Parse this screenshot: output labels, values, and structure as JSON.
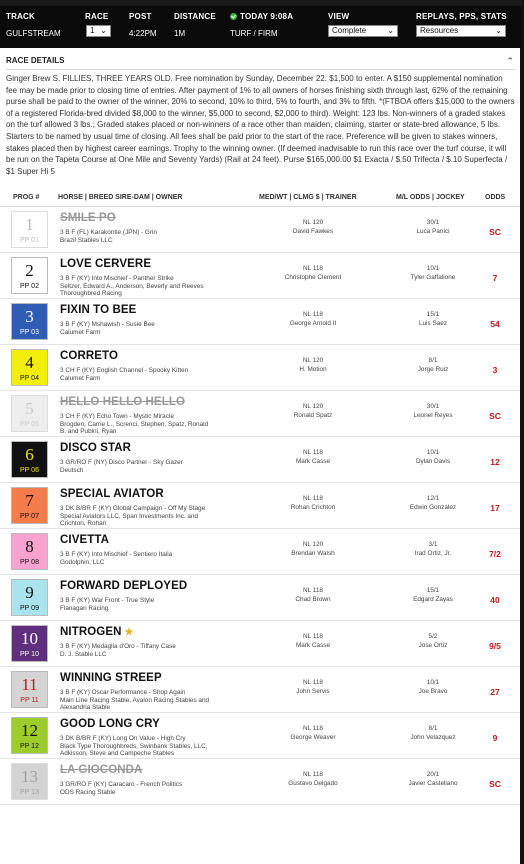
{
  "header": {
    "track_label": "TRACK",
    "track_value": "GULFSTREAM",
    "race_label": "RACE",
    "race_value": "1",
    "post_label": "POST",
    "post_value": "4:22PM",
    "distance_label": "DISTANCE",
    "distance_value": "1M",
    "today_label": "TODAY 9:08A",
    "surface_value": "TURF / FIRM",
    "view_label": "VIEW",
    "view_value": "Complete",
    "replays_label": "REPLAYS, PPS, STATS",
    "replays_value": "Resources"
  },
  "race_details": {
    "title": "RACE DETAILS",
    "text": "Ginger Brew S. FILLIES, THREE YEARS OLD. Free nomination by Sunday, December 22. $1,500 to enter. A $150 supplemental nomination fee may be made prior to closing time of entries. After payment of 1% to all owners of horses finishing sixth through last, 62% of the remaining purse shall be paid to the owner of the winner, 20% to second, 10% to third, 5% to fourth, and 3% to fifth. *(FTBOA offers $15,000 to the owners of a registered Florida-bred divided $8,000 to the winner, $5,000 to second, $2,000 to third). Weight: 123 lbs. Non-winners of a graded stakes on the turf allowed 3 lbs.; Graded stakes placed or non-winners of a race other than maiden, claiming, starter or state-bred allowance, 5 lbs. Starters to be named by usual time of closing. All fees shall be paid prior to the start of the race. Preference will be given to stakes winners, stakes placed then by highest career earnings. Trophy to the winning owner. (If deemed inadvisable to run this race over the turf course, it will be run on the Tapeta Course at One Mile and Seventy Yards) (Rail at 24 feet). Purse $165,000.00 $1 Exacta / $.50 Trifecta / $.10 Superfecta / $1 Super Hi 5"
  },
  "columns": {
    "prog": "PROG #",
    "horse": "HORSE | BREED SIRE-DAM | OWNER",
    "med": "MED/WT | CLMG $ | TRAINER",
    "ml": "M/L ODDS | JOCKEY",
    "odds": "ODDS"
  },
  "colors": {
    "header_bg": "#0b0b0b",
    "odds_red": "#c0171d",
    "scratched": "#999999"
  },
  "entries": [
    {
      "num": "1",
      "pp": "PP 01",
      "name": "SMILE PO",
      "scratched": true,
      "star": false,
      "line1": "3 B F (FL) Karakontie (JPN) - Grin",
      "line2": "Brazil Stables LLC",
      "line3": "",
      "med": "NL 120",
      "trainer": "David Fawkes",
      "ml": "30/1",
      "jockey": "Luca Panici",
      "odds": "SC",
      "bg": "#ffffff",
      "fg": "#777777"
    },
    {
      "num": "2",
      "pp": "PP 02",
      "name": "LOVE CERVERE",
      "scratched": false,
      "star": false,
      "line1": "3 B F (KY) Into Mischief - Panther Strike",
      "line2": "Seltzer, Edward A., Anderson, Beverly and Reeves",
      "line3": "Thoroughbred Racing",
      "med": "NL 118",
      "trainer": "Christophe Clement",
      "ml": "10/1",
      "jockey": "Tyler Gaffalione",
      "odds": "7",
      "bg": "#ffffff",
      "fg": "#111111"
    },
    {
      "num": "3",
      "pp": "PP 03",
      "name": "FIXIN TO BEE",
      "scratched": false,
      "star": false,
      "line1": "3 B F (KY) Mshawish - Susie Bee",
      "line2": "Calumet Farm",
      "line3": "",
      "med": "NL 118",
      "trainer": "George Arnold II",
      "ml": "15/1",
      "jockey": "Luis Saez",
      "odds": "54",
      "bg": "#2f5db4",
      "fg": "#ffffff"
    },
    {
      "num": "4",
      "pp": "PP 04",
      "name": "CORRETO",
      "scratched": false,
      "star": false,
      "line1": "3 CH F (KY) English Channel - Spooky Kitten",
      "line2": "Calumet Farm",
      "line3": "",
      "med": "NL 120",
      "trainer": "H. Motion",
      "ml": "8/1",
      "jockey": "Jorge Ruiz",
      "odds": "3",
      "bg": "#f2ee0b",
      "fg": "#111111"
    },
    {
      "num": "5",
      "pp": "PP 05",
      "name": "HELLO HELLO HELLO",
      "scratched": true,
      "star": false,
      "line1": "3 CH F (KY) Echo Town - Mystic Miracle",
      "line2": "Brogden, Carrie L., Screnci, Stephen, Spatz, Ronald",
      "line3": "B. and Pubini, Ryan",
      "med": "NL 120",
      "trainer": "Ronald Spatz",
      "ml": "30/1",
      "jockey": "Leonel Reyes",
      "odds": "SC",
      "bg": "#dcdcdc",
      "fg": "#999999"
    },
    {
      "num": "6",
      "pp": "PP 06",
      "name": "DISCO STAR",
      "scratched": false,
      "star": false,
      "line1": "3 GR/RO F (NY) Disco Partner - Sky Gazer",
      "line2": "Deutsch",
      "line3": "",
      "med": "NL 118",
      "trainer": "Mark Casse",
      "ml": "10/1",
      "jockey": "Dylan Davis",
      "odds": "12",
      "bg": "#111111",
      "fg": "#f2e80b"
    },
    {
      "num": "7",
      "pp": "PP 07",
      "name": "SPECIAL AVIATOR",
      "scratched": false,
      "star": false,
      "line1": "3 DK B/BR F (KY) Global Campaign - Off My Stage",
      "line2": "Special Aviators LLC, Span Investments Inc. and",
      "line3": "Crichton, Rohan",
      "med": "NL 118",
      "trainer": "Rohan Crichton",
      "ml": "12/1",
      "jockey": "Edwin Gonzalez",
      "odds": "17",
      "bg": "#f47c4a",
      "fg": "#111111"
    },
    {
      "num": "8",
      "pp": "PP 08",
      "name": "CIVETTA",
      "scratched": false,
      "star": false,
      "line1": "3 B F (KY) Into Mischief - Sentiero Italia",
      "line2": "Godolphin, LLC",
      "line3": "",
      "med": "NL 120",
      "trainer": "Brendan Walsh",
      "ml": "3/1",
      "jockey": "Irad Ortiz, Jr.",
      "odds": "7/2",
      "bg": "#f6a3cf",
      "fg": "#111111"
    },
    {
      "num": "9",
      "pp": "PP 09",
      "name": "FORWARD DEPLOYED",
      "scratched": false,
      "star": false,
      "line1": "3 B F (KY) War Front - True Style",
      "line2": "Flanagan Racing",
      "line3": "",
      "med": "NL 118",
      "trainer": "Chad Brown",
      "ml": "15/1",
      "jockey": "Edgard Zayas",
      "odds": "40",
      "bg": "#a8e3ee",
      "fg": "#111111"
    },
    {
      "num": "10",
      "pp": "PP 10",
      "name": "NITROGEN",
      "scratched": false,
      "star": true,
      "line1": "3 B F (KY) Medaglia d'Oro - Tiffany Case",
      "line2": "D. J. Stable LLC",
      "line3": "",
      "med": "NL 118",
      "trainer": "Mark Casse",
      "ml": "5/2",
      "jockey": "Jose Ortiz",
      "odds": "9/5",
      "bg": "#5f2f7d",
      "fg": "#ffffff"
    },
    {
      "num": "11",
      "pp": "PP 11",
      "name": "WINNING STREEP",
      "scratched": false,
      "star": false,
      "line1": "3 B F (KY) Oscar Performance - Shop Again",
      "line2": "Main Line Racing Stable, Avalon Racing Stables and",
      "line3": "Alexandria Stable",
      "med": "NL 118",
      "trainer": "John Servis",
      "ml": "10/1",
      "jockey": "Joe Bravo",
      "odds": "27",
      "bg": "#d4d4d4",
      "fg": "#c0171d"
    },
    {
      "num": "12",
      "pp": "PP 12",
      "name": "GOOD LONG CRY",
      "scratched": false,
      "star": false,
      "line1": "3 DK B/BR F (KY) Long On Value - High Cry",
      "line2": "Black Type Thoroughbreds, Swinbank Stables, LLC,",
      "line3": "Adkisson, Steve and Campeche Stables",
      "med": "NL 118",
      "trainer": "George Weaver",
      "ml": "8/1",
      "jockey": "John Velazquez",
      "odds": "9",
      "bg": "#9ccd2a",
      "fg": "#111111"
    },
    {
      "num": "13",
      "pp": "PP 13",
      "name": "LA GIOCONDA",
      "scratched": true,
      "star": false,
      "line1": "3 GR/RO F (KY) Caracaro - French Politics",
      "line2": "ODS Racing Stable",
      "line3": "",
      "med": "NL 118",
      "trainer": "Gustavo Delgado",
      "ml": "20/1",
      "jockey": "Javier Castellano",
      "odds": "SC",
      "bg": "#a9a9a9",
      "fg": "#444444"
    }
  ]
}
